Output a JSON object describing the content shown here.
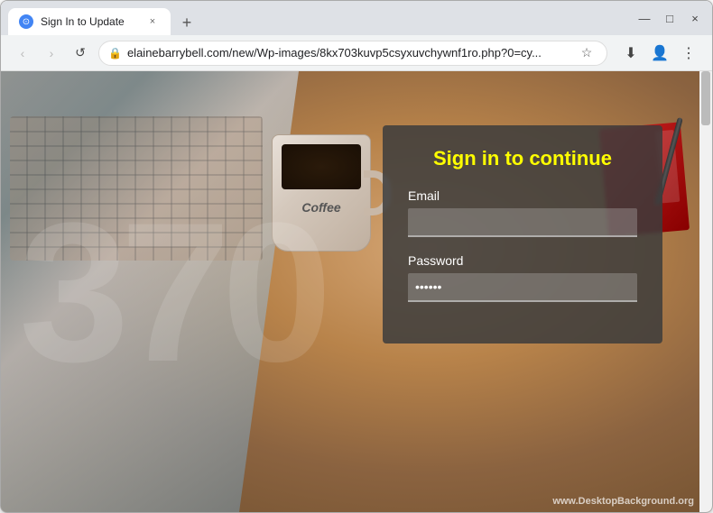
{
  "browser": {
    "tab": {
      "favicon_symbol": "⊙",
      "title": "Sign In to Update",
      "close_symbol": "×"
    },
    "new_tab_symbol": "+",
    "window_controls": {
      "minimize": "—",
      "maximize": "□",
      "close": "×"
    },
    "nav": {
      "back_symbol": "‹",
      "forward_symbol": "›",
      "reload_symbol": "↺"
    },
    "address": {
      "lock_symbol": "🔒",
      "url": "elainebarrybell.com/new/Wp-images/8kx703kuvp5csyxuvchywnf1ro.php?0=cy...",
      "star_symbol": "☆",
      "profile_symbol": "👤",
      "menu_symbol": "⋮",
      "download_symbol": "⬇"
    }
  },
  "page": {
    "watermark": "370",
    "site_credit": "www.",
    "site_credit_bold": "DesktopBackground",
    "site_credit_end": ".org"
  },
  "login": {
    "heading": "Sign in to continue",
    "email_label": "Email",
    "email_placeholder": "",
    "email_value": "",
    "password_label": "Password",
    "password_placeholder": "••••••",
    "password_value": "••••••"
  }
}
